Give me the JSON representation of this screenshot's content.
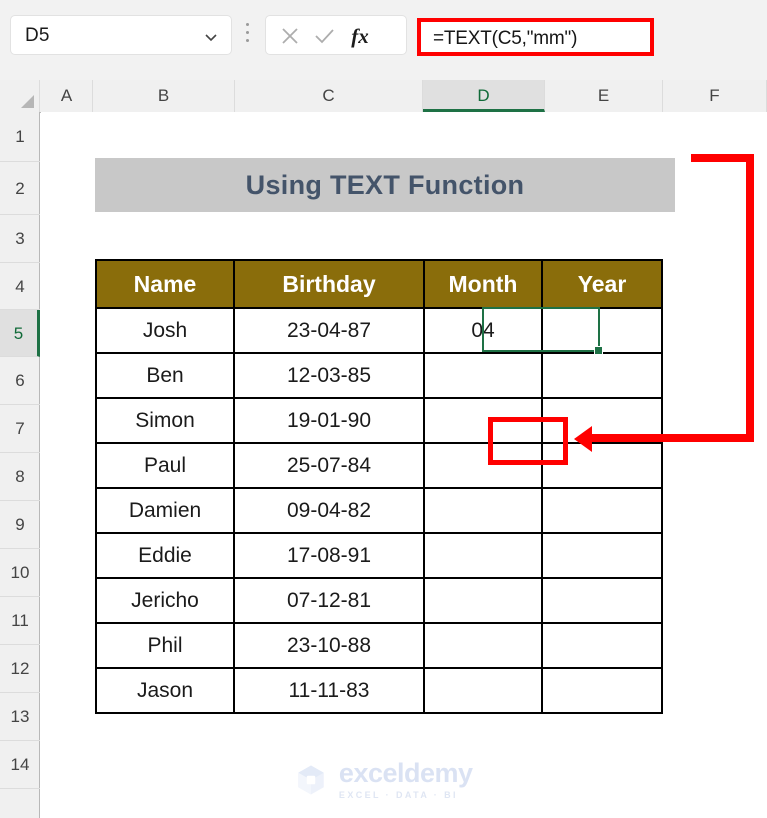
{
  "app": {
    "name_box": {
      "value": "D5",
      "chevron_icon": "chevron-down-icon"
    },
    "kebab_icon": "more-options-icon",
    "cancel_icon": "cancel-icon",
    "confirm_icon": "confirm-check-icon",
    "fx_icon": "fx",
    "formula": "=TEXT(C5,\"mm\")"
  },
  "grid": {
    "columns": [
      "A",
      "B",
      "C",
      "D",
      "E",
      "F"
    ],
    "selected_column": "D",
    "rows": [
      "1",
      "2",
      "3",
      "4",
      "5",
      "6",
      "7",
      "8",
      "9",
      "10",
      "11",
      "12",
      "13",
      "14"
    ],
    "selected_row": "5"
  },
  "sheet": {
    "title": "Using TEXT Function",
    "headers": [
      "Name",
      "Birthday",
      "Month",
      "Year"
    ],
    "rows": [
      {
        "name": "Josh",
        "birthday": "23-04-87",
        "month": "04",
        "year": ""
      },
      {
        "name": "Ben",
        "birthday": "12-03-85",
        "month": "",
        "year": ""
      },
      {
        "name": "Simon",
        "birthday": "19-01-90",
        "month": "",
        "year": ""
      },
      {
        "name": "Paul",
        "birthday": "25-07-84",
        "month": "",
        "year": ""
      },
      {
        "name": "Damien",
        "birthday": "09-04-82",
        "month": "",
        "year": ""
      },
      {
        "name": "Eddie",
        "birthday": "17-08-91",
        "month": "",
        "year": ""
      },
      {
        "name": "Jericho",
        "birthday": "07-12-81",
        "month": "",
        "year": ""
      },
      {
        "name": "Phil",
        "birthday": "23-10-88",
        "month": "",
        "year": ""
      },
      {
        "name": "Jason",
        "birthday": "11-11-83",
        "month": "",
        "year": ""
      }
    ]
  },
  "annotation": {
    "color": "#ff0000",
    "arrow_icon": "arrow-left-icon"
  },
  "watermark": {
    "name": "exceldemy",
    "tagline": "EXCEL · DATA · BI",
    "logo_icon": "exceldemy-cube-logo-icon"
  },
  "colors": {
    "table_header": "#8a6d0b",
    "title_banner": "#c8c8c8",
    "title_text": "#44546a",
    "selection": "#1e7145",
    "annotation": "#ff0000"
  }
}
